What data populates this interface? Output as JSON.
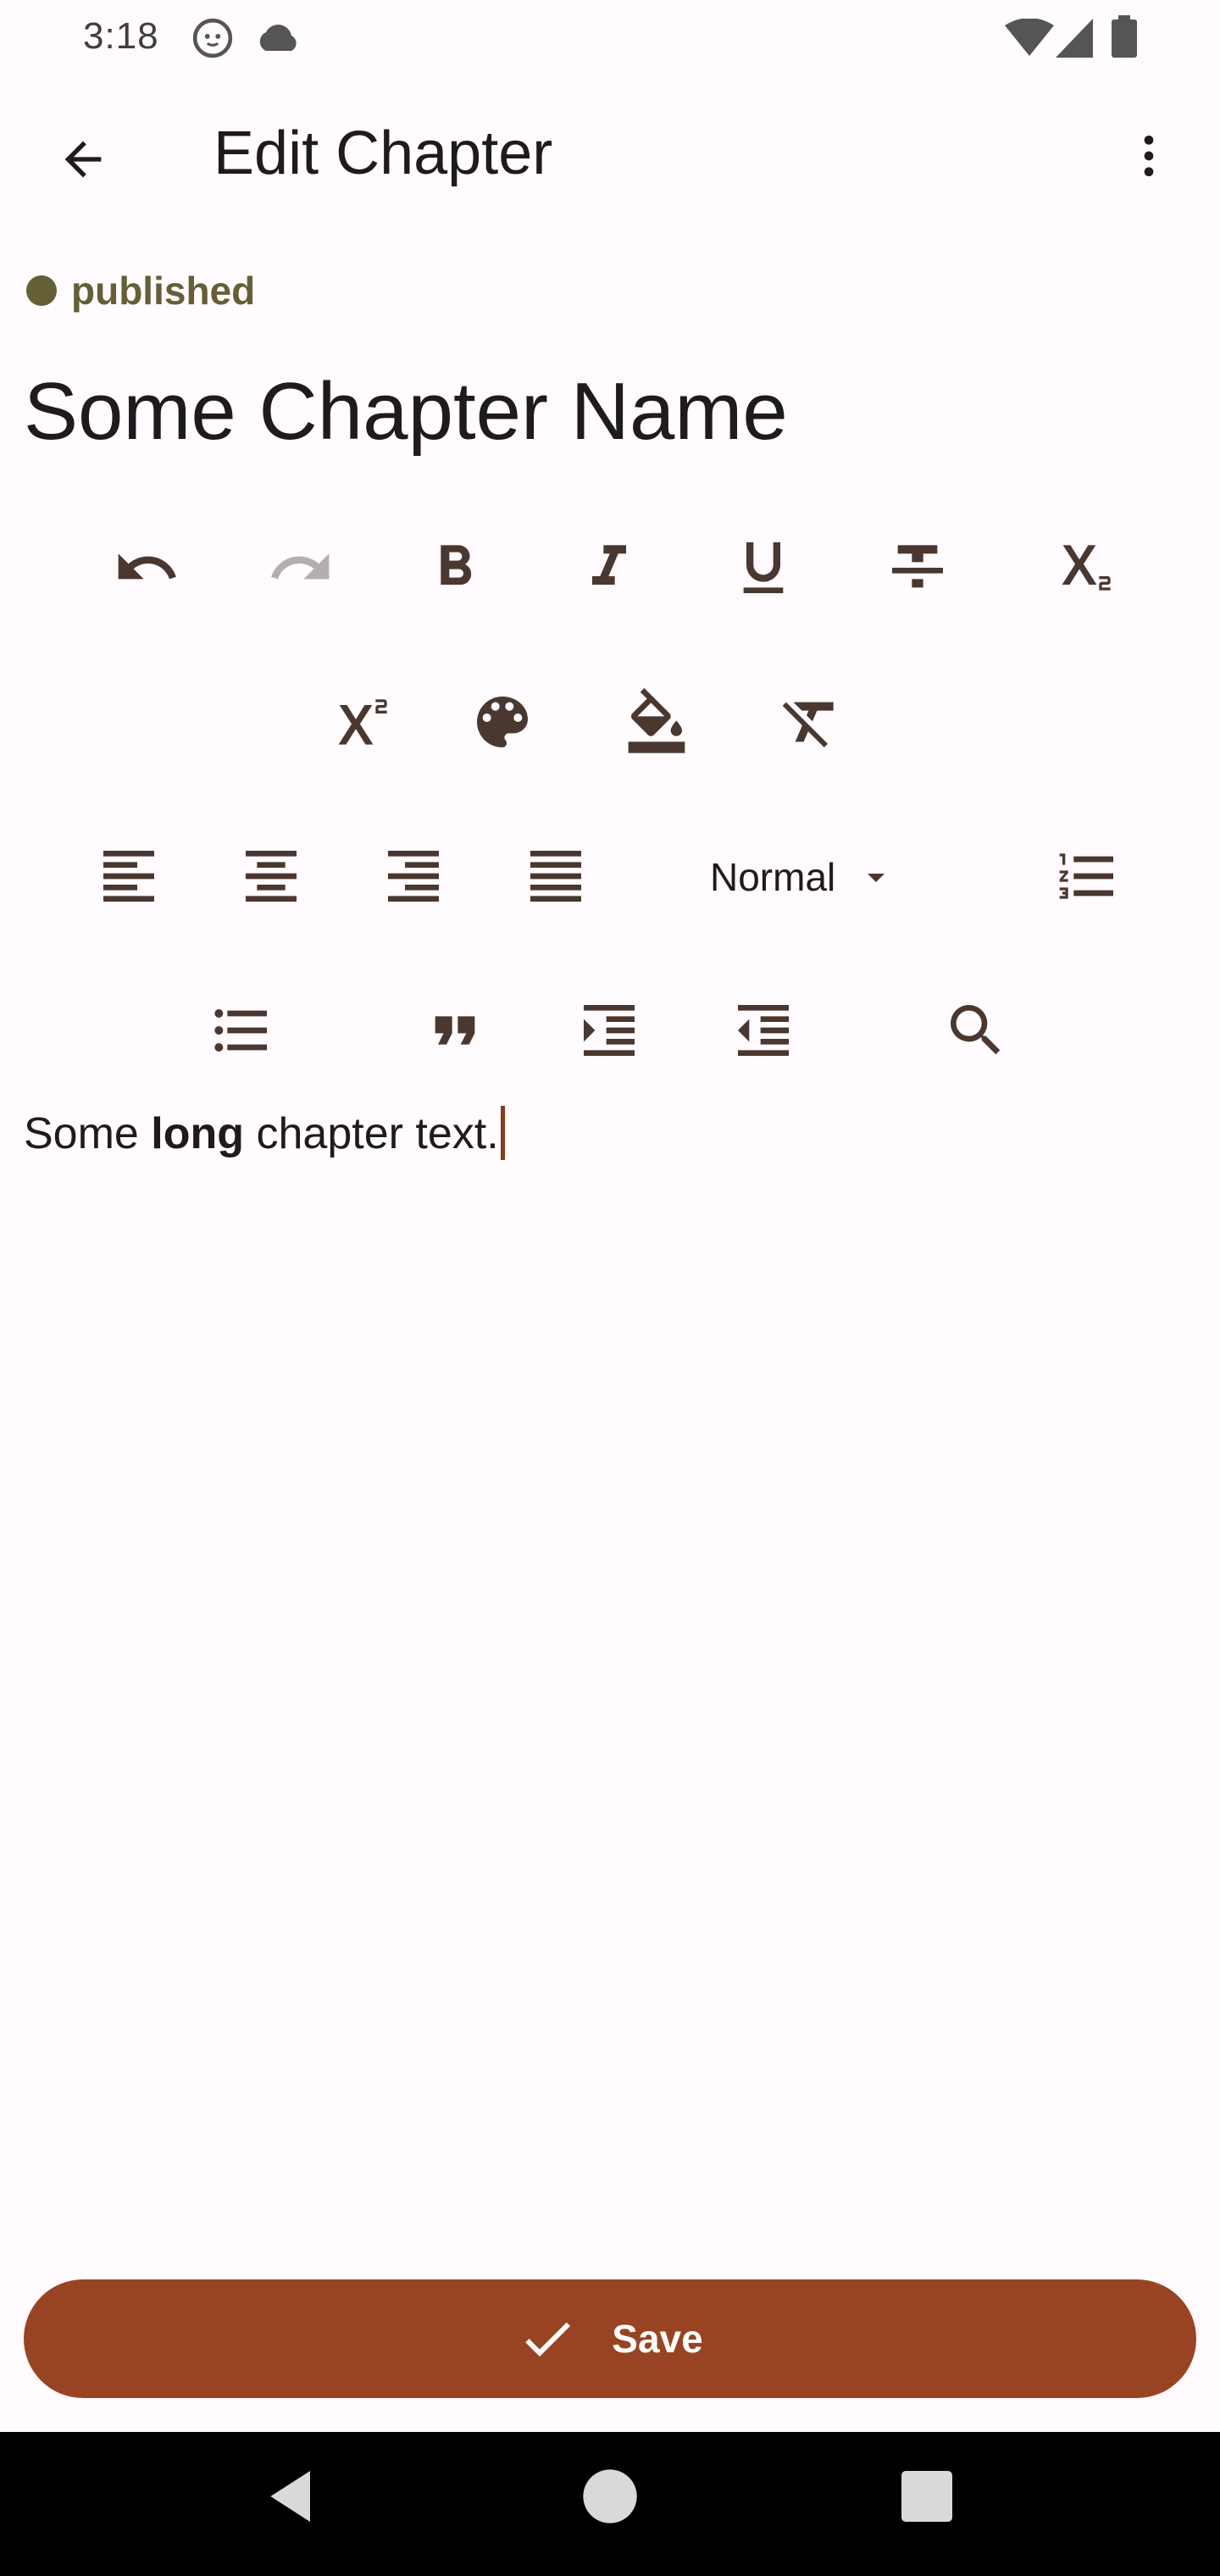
{
  "status_bar": {
    "time": "3:18",
    "icons": [
      "cat-notification-icon",
      "cloud-icon",
      "wifi-icon",
      "signal-icon",
      "battery-icon"
    ]
  },
  "app_bar": {
    "title": "Edit Chapter",
    "back_icon": "arrow-back-icon",
    "more_icon": "more-vert-icon"
  },
  "chapter": {
    "status": "published",
    "status_color": "#645f35",
    "name": "Some Chapter Name"
  },
  "toolbar": {
    "rows": [
      [
        "undo",
        "redo",
        "bold",
        "italic",
        "underline",
        "strikethrough",
        "subscript"
      ],
      [
        "superscript",
        "text-color",
        "background-color",
        "clear-format"
      ],
      [
        "align-left",
        "align-center",
        "align-right",
        "align-justify",
        "heading-select",
        "ordered-list"
      ],
      [
        "bullet-list",
        "blockquote",
        "indent",
        "outdent",
        "search"
      ]
    ],
    "format_select": {
      "selected": "Normal"
    }
  },
  "editor": {
    "text_before": "Some ",
    "text_bold": "long",
    "text_after": " chapter text."
  },
  "save_button": {
    "label": "Save"
  },
  "colors": {
    "accent": "#984423",
    "icon": "#4a372f",
    "disabled_icon": "#b5aeac",
    "background": "#fffbfe"
  }
}
